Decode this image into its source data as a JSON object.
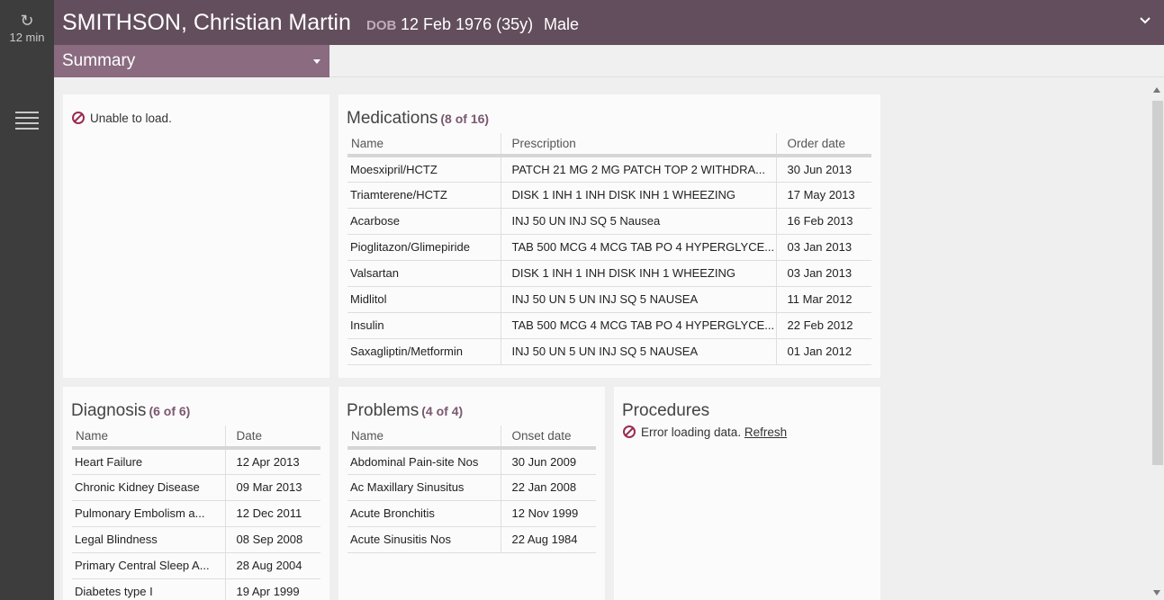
{
  "rail": {
    "refresh_label": "12 min"
  },
  "header": {
    "patient_name": "SMITHSON, Christian Martin",
    "dob_label": "DOB",
    "dob_value": "12 Feb 1976 (35y)",
    "sex": "Male"
  },
  "summary_tab": {
    "label": "Summary"
  },
  "unknown_card": {
    "message": "Unable to load."
  },
  "medications": {
    "title": "Medications",
    "count": "(8 of 16)",
    "columns": [
      "Name",
      "Prescription",
      "Order date"
    ],
    "rows": [
      [
        "Moesxipril/HCTZ",
        "PATCH 21 MG 2 MG PATCH TOP 2 WITHDRA...",
        "30 Jun 2013"
      ],
      [
        "Triamterene/HCTZ",
        "DISK 1 INH 1 INH DISK INH 1 WHEEZING",
        "17 May 2013"
      ],
      [
        "Acarbose",
        "INJ 50 UN INJ SQ 5 Nausea",
        "16 Feb 2013"
      ],
      [
        "Pioglitazon/Glimepiride",
        "TAB 500 MCG 4 MCG TAB PO 4 HYPERGLYCE...",
        "03 Jan 2013"
      ],
      [
        "Valsartan",
        "DISK 1 INH 1 INH DISK INH 1 WHEEZING",
        "03 Jan 2013"
      ],
      [
        "Midlitol",
        "INJ 50 UN 5 UN INJ SQ 5 NAUSEA",
        "11 Mar 2012"
      ],
      [
        "Insulin",
        "TAB 500 MCG 4 MCG TAB PO 4 HYPERGLYCE...",
        "22 Feb 2012"
      ],
      [
        "Saxagliptin/Metformin",
        "INJ 50 UN 5 UN INJ SQ 5 NAUSEA",
        "01 Jan 2012"
      ]
    ]
  },
  "diagnosis": {
    "title": "Diagnosis",
    "count": "(6 of 6)",
    "columns": [
      "Name",
      "Date"
    ],
    "rows": [
      [
        "Heart Failure",
        "12 Apr 2013"
      ],
      [
        "Chronic Kidney Disease",
        "09 Mar 2013"
      ],
      [
        "Pulmonary Embolism a...",
        "12 Dec 2011"
      ],
      [
        "Legal Blindness",
        "08 Sep 2008"
      ],
      [
        "Primary Central Sleep A...",
        "28 Aug 2004"
      ],
      [
        "Diabetes type I",
        "19 Apr 1999"
      ]
    ]
  },
  "problems": {
    "title": "Problems",
    "count": "(4 of 4)",
    "columns": [
      "Name",
      "Onset date"
    ],
    "rows": [
      [
        "Abdominal Pain-site Nos",
        "30 Jun 2009"
      ],
      [
        "Ac Maxillary Sinusitus",
        "22 Jan 2008"
      ],
      [
        "Acute Bronchitis",
        "12 Nov 1999"
      ],
      [
        "Acute Sinusitis Nos",
        "22 Aug 1984"
      ]
    ]
  },
  "procedures": {
    "title": "Procedures",
    "error_message": "Error loading data.",
    "refresh_link": "Refresh"
  },
  "colors": {
    "header_bg": "#634e5d",
    "tab_bg": "#8a6b80",
    "rail_bg": "#3d3d3d",
    "error": "#9b2c4f",
    "count": "#7a5870"
  },
  "icons": [
    "refresh-icon",
    "menu-list-icon",
    "chevron-down-icon",
    "error-icon"
  ]
}
